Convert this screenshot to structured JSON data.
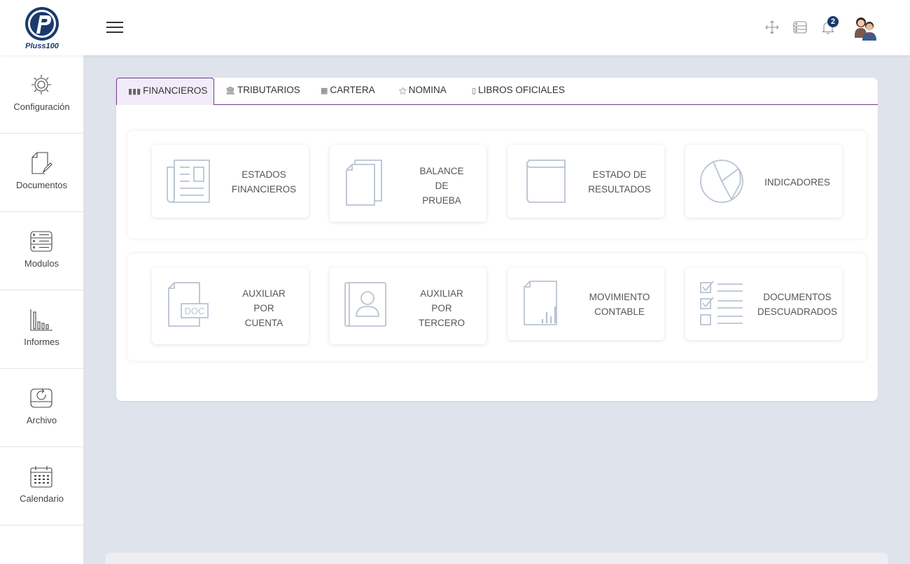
{
  "header": {
    "logo_alt": "Pluss100",
    "notification_count": "2",
    "icons": [
      "logo-icon",
      "menu-icon",
      "fullscreen-icon",
      "server-icon",
      "bell-icon",
      "avatar"
    ]
  },
  "sidebar": {
    "items": [
      {
        "label": "Configuración",
        "icon": "gear-icon"
      },
      {
        "label": "Documentos",
        "icon": "document-edit-icon"
      },
      {
        "label": "Modulos",
        "icon": "server-stack-icon"
      },
      {
        "label": "Informes",
        "icon": "bar-chart-icon"
      },
      {
        "label": "Archivo",
        "icon": "archive-icon"
      },
      {
        "label": "Calendario",
        "icon": "calendar-icon"
      }
    ]
  },
  "tabs": [
    {
      "label": "FINANCIEROS",
      "icon": "bar-chart-icon",
      "active": true
    },
    {
      "label": "TRIBUTARIOS",
      "icon": "bank-icon",
      "active": false
    },
    {
      "label": "CARTERA",
      "icon": "money-icon",
      "active": false
    },
    {
      "label": "NOMINA",
      "icon": "person-icon",
      "active": false
    },
    {
      "label": "LIBROS OFICIALES",
      "icon": "book-icon",
      "active": false
    }
  ],
  "cards_row1": [
    {
      "label": "ESTADOS\nFINANCIEROS",
      "icon": "newspaper-icon"
    },
    {
      "label": "BALANCE\nDE\nPRUEBA",
      "icon": "copy-icon"
    },
    {
      "label": "ESTADO DE\nRESULTADOS",
      "icon": "book-icon"
    },
    {
      "label": "INDICADORES",
      "icon": "pie-chart-icon"
    }
  ],
  "cards_row2": [
    {
      "label": "AUXILIAR\nPOR\nCUENTA",
      "icon": "doc-file-icon",
      "icon_text": "DOC"
    },
    {
      "label": "AUXILIAR\nPOR\nTERCERO",
      "icon": "contact-icon"
    },
    {
      "label": "MOVIMIENTO\nCONTABLE",
      "icon": "file-chart-icon"
    },
    {
      "label": "DOCUMENTOS\nDESCUADRADOS",
      "icon": "checklist-icon"
    }
  ],
  "colors": {
    "accent": "#6b3d8c",
    "brand": "#1a3a6e",
    "background": "#dfe3ec",
    "icon_stroke": "#b9c3d2"
  }
}
